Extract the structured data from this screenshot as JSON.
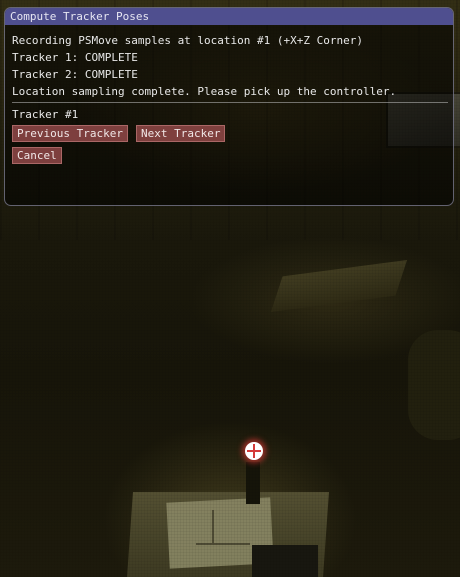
{
  "window": {
    "title": "Compute Tracker Poses"
  },
  "status": {
    "recording_line": "Recording PSMove samples at location #1 (+X+Z Corner)",
    "tracker_statuses": [
      "Tracker 1: COMPLETE",
      "Tracker 2: COMPLETE"
    ],
    "completion_message": "Location sampling complete. Please pick up the controller."
  },
  "tracker_view": {
    "current_tracker_label": "Tracker #1"
  },
  "buttons": {
    "previous_label": "Previous Tracker",
    "next_label": "Next Tracker",
    "cancel_label": "Cancel"
  },
  "colors": {
    "title_bar": "#55559b",
    "button": "#964b4b",
    "text": "#e8e8e8",
    "marker_glow": "#ff3c3c"
  }
}
